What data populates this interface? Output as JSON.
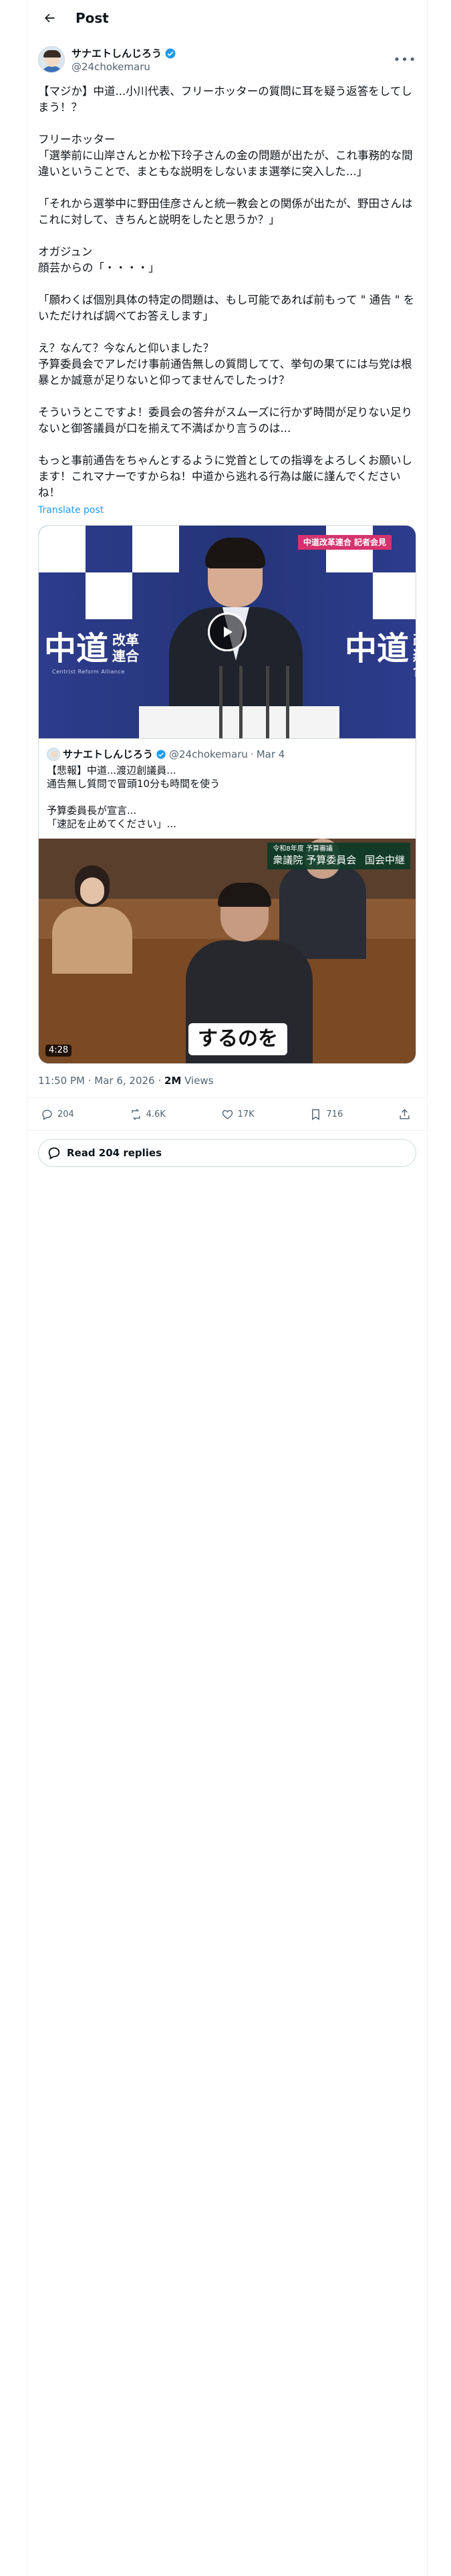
{
  "header": {
    "title": "Post"
  },
  "author": {
    "display_name": "サナエトしんじろう",
    "handle": "@24chokemaru"
  },
  "tweet": {
    "text": "【マジか】中道...小川代表、フリーホッターの質問に耳を疑う返答をしてしまう！？\n\nフリーホッター\n「選挙前に山岸さんとか松下玲子さんの金の問題が出たが、これ事務的な間違いということで、まともな説明をしないまま選挙に突入した...」\n\n「それから選挙中に野田佳彦さんと統一教会との関係が出たが、野田さんはこれに対して、きちんと説明をしたと思うか？」\n\nオガジュン\n顔芸からの「・・・・」\n\n「願わくば個別具体の特定の問題は、もし可能であれば前もって \" 通告 \" をいただければ調べてお答えします」\n\nえ？なんて？今なんと仰いました？\n予算委員会でアレだけ事前通告無しの質問してて、挙句の果てには与党は根暴とか誠意が足りないと仰ってませんでしたっけ？\n\nそういうとこですよ！委員会の答弁がスムーズに行かず時間が足りない足りないと御答議員が口を揃えて不満ばかり言うのは...\n\nもっと事前通告をちゃんとするように党首としての指導をよろしくお願いします！これマナーですからね！中道から逃れる行為は厳に謹んでくださいね！",
    "translate_label": "Translate post"
  },
  "video1": {
    "banner": "中道改革連合  記者会見",
    "logo_main": "中道",
    "logo_sub1": "改革",
    "logo_sub2": "連合",
    "logo_en": "Centrist Reform Alliance"
  },
  "quote": {
    "display_name": "サナエトしんじろう",
    "handle": "@24chokemaru",
    "date": "Mar 4",
    "text": "【悲報】中道...渡辺創議員...\n通告無し質問で冒頭10分も時間を使う\n\n予算委員長が宣言...\n「速記を止めてください」...",
    "tv_label_small": "令和8年度 予算審議",
    "tv_label": "衆議院 予算委員会",
    "tv_label_right": "国会中継",
    "caption": "するのを",
    "duration": "4:28"
  },
  "meta": {
    "time": "11:50 PM · Mar 6, 2026",
    "views_count": "2M",
    "views_label": "Views"
  },
  "actions": {
    "replies": "204",
    "reposts": "4.6K",
    "likes": "17K",
    "bookmarks": "716"
  },
  "read_replies": "Read 204 replies",
  "colors": {
    "accent": "#1d9bf0",
    "text": "#0f1419",
    "muted": "#536471",
    "border": "#cfd9de"
  }
}
